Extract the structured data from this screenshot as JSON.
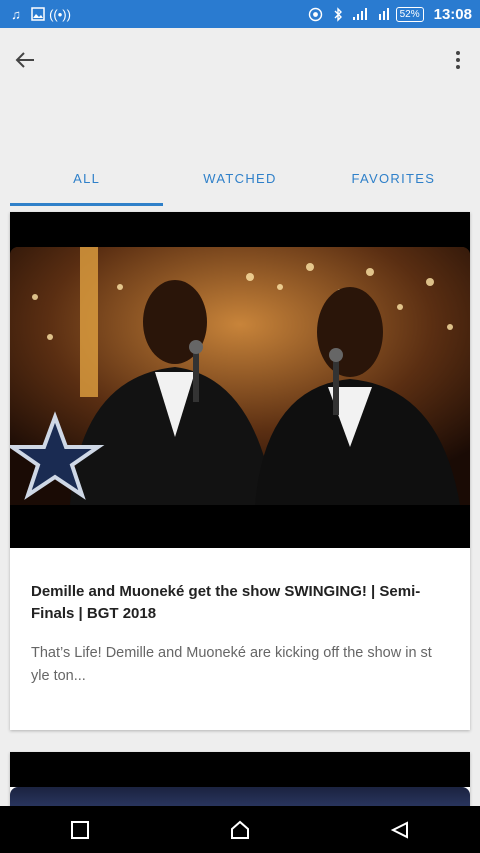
{
  "status_bar": {
    "left_icons": [
      "music-note-icon",
      "image-icon",
      "wifi-hotspot-icon"
    ],
    "right_icons": [
      "cast-icon",
      "bluetooth-icon",
      "signal-icon",
      "signal-4g-icon"
    ],
    "battery": "52%",
    "time": "13:08"
  },
  "tabs": [
    {
      "label": "ALL",
      "active": true
    },
    {
      "label": "WATCHED",
      "active": false
    },
    {
      "label": "FAVORITES",
      "active": false
    }
  ],
  "videos": [
    {
      "title": "Demille and Muoneké get the show SWINGING! | Semi-Finals | BGT 2018",
      "description": "That’s Life! Demille and Muoneké are kicking off the show in st yle ton..."
    }
  ],
  "colors": {
    "status_bar": "#2a7bd0",
    "accent": "#2f80c9",
    "background": "#eeeeee"
  }
}
